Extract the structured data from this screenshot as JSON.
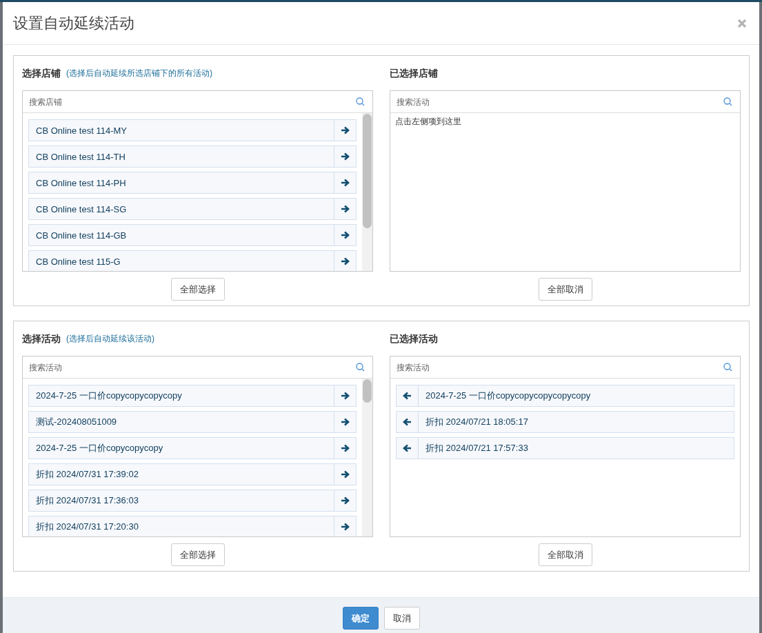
{
  "dialog": {
    "title": "设置自动延续活动"
  },
  "sections": [
    {
      "source": {
        "title": "选择店铺",
        "hint": "(选择后自动延续所选店铺下的所有活动)",
        "search": {
          "placeholder": "搜索店铺"
        },
        "items": [
          {
            "label": "CB Online test 114-MY"
          },
          {
            "label": "CB Online test 114-TH"
          },
          {
            "label": "CB Online test 114-PH"
          },
          {
            "label": "CB Online test 114-SG"
          },
          {
            "label": "CB Online test 114-GB"
          },
          {
            "label": "CB Online test 115-G"
          }
        ],
        "button": "全部选择"
      },
      "target": {
        "title": "已选择店铺",
        "search": {
          "placeholder": "搜索活动"
        },
        "empty_text": "点击左侧项到这里",
        "button": "全部取消"
      }
    },
    {
      "source": {
        "title": "选择活动",
        "hint": "(选择后自动延续该活动)",
        "search": {
          "placeholder": "搜索活动"
        },
        "items": [
          {
            "label": "2024-7-25 一口价copycopycopycopy"
          },
          {
            "label": "测试-202408051009"
          },
          {
            "label": "2024-7-25 一口价copycopycopy"
          },
          {
            "label": "折扣 2024/07/31 17:39:02"
          },
          {
            "label": "折扣 2024/07/31 17:36:03"
          },
          {
            "label": "折扣 2024/07/31 17:20:30"
          }
        ],
        "button": "全部选择"
      },
      "target": {
        "title": "已选择活动",
        "search": {
          "placeholder": "搜索活动"
        },
        "items": [
          {
            "label": "2024-7-25 一口价copycopycopycopycopy"
          },
          {
            "label": "折扣 2024/07/21 18:05:17"
          },
          {
            "label": "折扣 2024/07/21 17:57:33"
          }
        ],
        "button": "全部取消"
      }
    }
  ],
  "footer": {
    "buttons": [
      {
        "label": "确定",
        "kind": "primary"
      },
      {
        "label": "取消",
        "kind": "default"
      }
    ]
  }
}
